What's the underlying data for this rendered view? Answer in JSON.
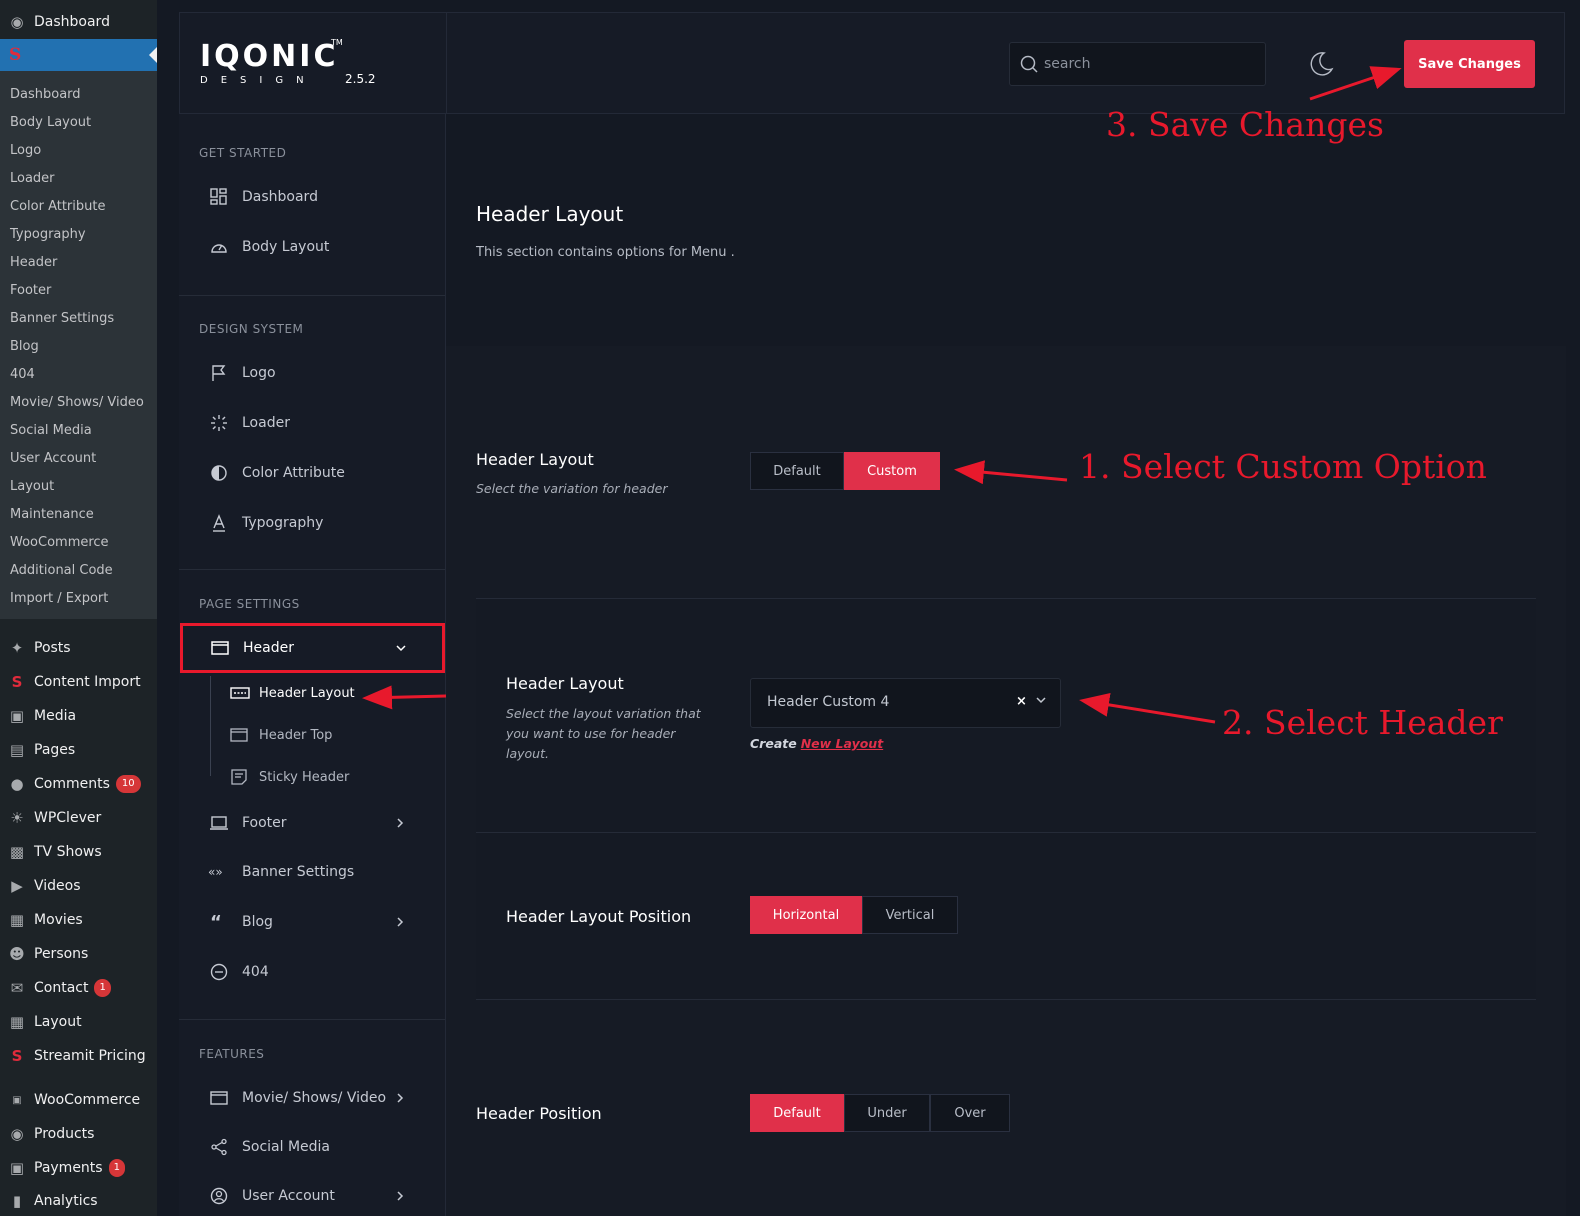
{
  "wp_menu": {
    "dashboard": "Dashboard",
    "submenu": [
      "Dashboard",
      "Body Layout",
      "Logo",
      "Loader",
      "Color Attribute",
      "Typography",
      "Header",
      "Footer",
      "Banner Settings",
      "Blog",
      "404",
      "Movie/ Shows/ Video",
      "Social Media",
      "User Account",
      "Layout",
      "Maintenance",
      "WooCommerce",
      "Additional Code",
      "Import / Export"
    ],
    "items": [
      {
        "label": "Posts",
        "icon": "pin-icon"
      },
      {
        "label": "Content Import",
        "icon": "s-logo-icon"
      },
      {
        "label": "Media",
        "icon": "media-icon"
      },
      {
        "label": "Pages",
        "icon": "pages-icon"
      },
      {
        "label": "Comments",
        "icon": "comment-icon",
        "badge": "10"
      },
      {
        "label": "WPClever",
        "icon": "bulb-icon"
      },
      {
        "label": "TV Shows",
        "icon": "tv-icon"
      },
      {
        "label": "Videos",
        "icon": "video-icon"
      },
      {
        "label": "Movies",
        "icon": "film-icon"
      },
      {
        "label": "Persons",
        "icon": "person-icon"
      },
      {
        "label": "Contact",
        "icon": "mail-icon",
        "badge": "1"
      },
      {
        "label": "Layout",
        "icon": "grid-icon"
      },
      {
        "label": "Streamit Pricing",
        "icon": "s-logo-icon"
      },
      {
        "label": "WooCommerce",
        "icon": "woo-icon"
      },
      {
        "label": "Products",
        "icon": "products-icon"
      },
      {
        "label": "Payments",
        "icon": "payments-icon",
        "badge": "1"
      },
      {
        "label": "Analytics",
        "icon": "analytics-icon"
      }
    ]
  },
  "header": {
    "logo": "IQONIC",
    "logo_tm": "TM",
    "logo_sub": "DESIGN",
    "version": "2.5.2",
    "search_placeholder": "search",
    "save_label": "Save Changes"
  },
  "nav": {
    "sections": {
      "get_started": "GET STARTED",
      "design_system": "DESIGN SYSTEM",
      "page_settings": "PAGE SETTINGS",
      "features": "FEATURES"
    },
    "items": {
      "dashboard": "Dashboard",
      "body_layout": "Body Layout",
      "logo": "Logo",
      "loader": "Loader",
      "color_attribute": "Color Attribute",
      "typography": "Typography",
      "header": "Header",
      "header_layout": "Header Layout",
      "header_top": "Header Top",
      "sticky_header": "Sticky Header",
      "footer": "Footer",
      "banner_settings": "Banner Settings",
      "blog": "Blog",
      "e404": "404",
      "movie_shows": "Movie/ Shows/ Video",
      "social_media": "Social Media",
      "user_account": "User Account"
    }
  },
  "content": {
    "title": "Header Layout",
    "description": "This section contains options for Menu .",
    "opt1": {
      "label": "Header Layout",
      "desc": "Select the variation for header",
      "options": [
        "Default",
        "Custom"
      ],
      "selected": "Custom"
    },
    "opt2": {
      "label": "Header Layout",
      "desc": "Select the layout variation that you want to use for header layout.",
      "value": "Header Custom 4",
      "clear": "×",
      "create_text": "Create",
      "create_link": "New Layout"
    },
    "opt3": {
      "label": "Header Layout Position",
      "options": [
        "Horizontal",
        "Vertical"
      ],
      "selected": "Horizontal"
    },
    "opt4": {
      "label": "Header Position",
      "options": [
        "Default",
        "Under",
        "Over"
      ],
      "selected": "Default"
    }
  },
  "annotations": {
    "step1": "1. Select Custom Option",
    "step2": "2. Select Header",
    "step3": "3. Save Changes"
  },
  "colors": {
    "accent": "#e0304a",
    "annotation": "#e8192c",
    "wp_active": "#2271b1"
  }
}
